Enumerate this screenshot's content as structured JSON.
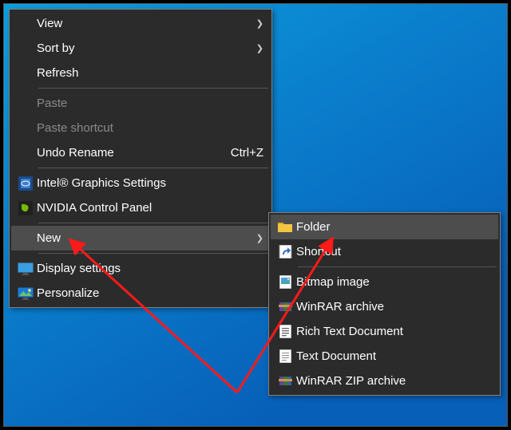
{
  "menu": {
    "view": "View",
    "sort_by": "Sort by",
    "refresh": "Refresh",
    "paste": "Paste",
    "paste_shortcut": "Paste shortcut",
    "undo_rename": "Undo Rename",
    "undo_rename_shortcut": "Ctrl+Z",
    "intel": "Intel® Graphics Settings",
    "nvidia": "NVIDIA Control Panel",
    "new": "New",
    "display_settings": "Display settings",
    "personalize": "Personalize"
  },
  "submenu": {
    "folder": "Folder",
    "shortcut": "Shortcut",
    "bitmap": "Bitmap image",
    "winrar": "WinRAR archive",
    "rtf": "Rich Text Document",
    "txt": "Text Document",
    "winrar_zip": "WinRAR ZIP archive"
  }
}
